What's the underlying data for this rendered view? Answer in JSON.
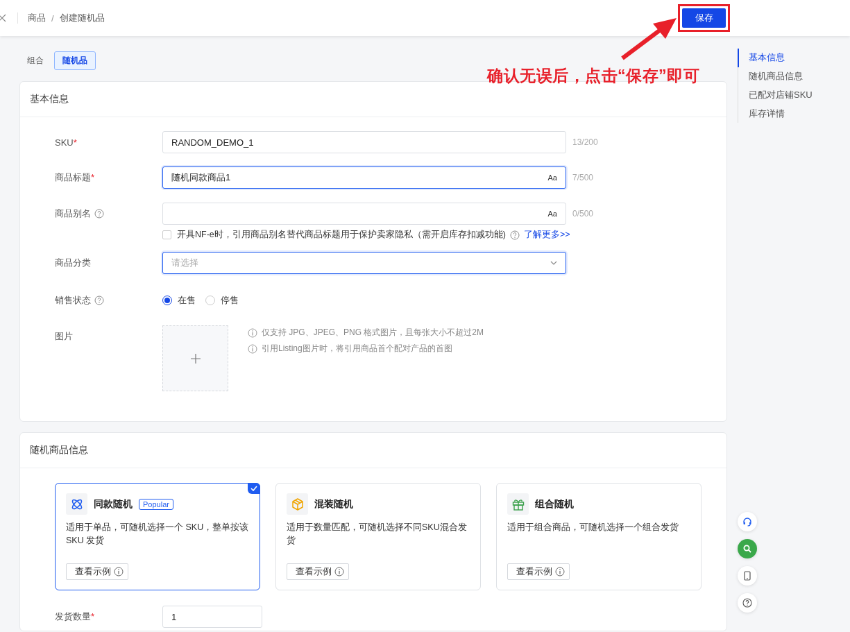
{
  "header": {
    "breadcrumb": [
      {
        "label": "商品",
        "current": false
      },
      {
        "label": "创建随机品",
        "current": true
      }
    ],
    "separator": "/",
    "save_button": "保存"
  },
  "annotation": {
    "text": "确认无误后，点击“保存”即可"
  },
  "type_tabs": [
    {
      "label": "组合",
      "selected": false
    },
    {
      "label": "随机品",
      "selected": true
    }
  ],
  "basic_info": {
    "title": "基本信息",
    "fields": [
      {
        "kind": "text",
        "label": "SKU",
        "required_mark": "*",
        "value": "RANDOM_DEMO_1",
        "counter": "13/200",
        "focused": false
      },
      {
        "kind": "text",
        "label": "商品标题",
        "required_mark": "*",
        "value": "随机同款商品1",
        "case_toggle": "Aa",
        "counter": "7/500",
        "focused": true
      },
      {
        "kind": "text",
        "label": "商品别名",
        "help": true,
        "case_toggle": "Aa",
        "counter": "0/500",
        "focused": false,
        "checkbox": {
          "label": "开具NF-e时，引用商品别名替代商品标题用于保护卖家隐私（需开启库存扣减功能)",
          "checked": false,
          "help": true,
          "link": "了解更多>>"
        }
      },
      {
        "kind": "select",
        "label": "商品分类",
        "placeholder": "请选择",
        "focused": true
      },
      {
        "kind": "radio",
        "label": "销售状态",
        "help": true,
        "options": [
          {
            "label": "在售",
            "selected": true
          },
          {
            "label": "停售",
            "selected": false
          }
        ]
      },
      {
        "kind": "upload",
        "label": "图片",
        "notes": [
          "仅支持 JPG、JPEG、PNG 格式图片，且每张大小不超过2M",
          "引用Listing图片时，将引用商品首个配对产品的首图"
        ]
      }
    ]
  },
  "random_info": {
    "title": "随机商品信息",
    "options": [
      {
        "kind": "same",
        "title": "同款随机",
        "badge": "Popular",
        "description": "适用于单品，可随机选择一个 SKU，整单按该 SKU 发货",
        "button": "查看示例",
        "selected": true
      },
      {
        "kind": "mixed",
        "title": "混装随机",
        "description": "适用于数量匹配，可随机选择不同SKU混合发货",
        "button": "查看示例",
        "selected": false
      },
      {
        "kind": "combo",
        "title": "组合随机",
        "description": "适用于组合商品，可随机选择一个组合发货",
        "button": "查看示例",
        "selected": false
      }
    ],
    "quantity": {
      "label": "发货数量",
      "required_mark": "*",
      "value": "1"
    }
  },
  "anchor_nav": [
    {
      "label": "基本信息",
      "selected": true
    },
    {
      "label": "随机商品信息",
      "selected": false
    },
    {
      "label": "已配对店铺SKU",
      "selected": false
    },
    {
      "label": "库存详情",
      "selected": false
    }
  ]
}
